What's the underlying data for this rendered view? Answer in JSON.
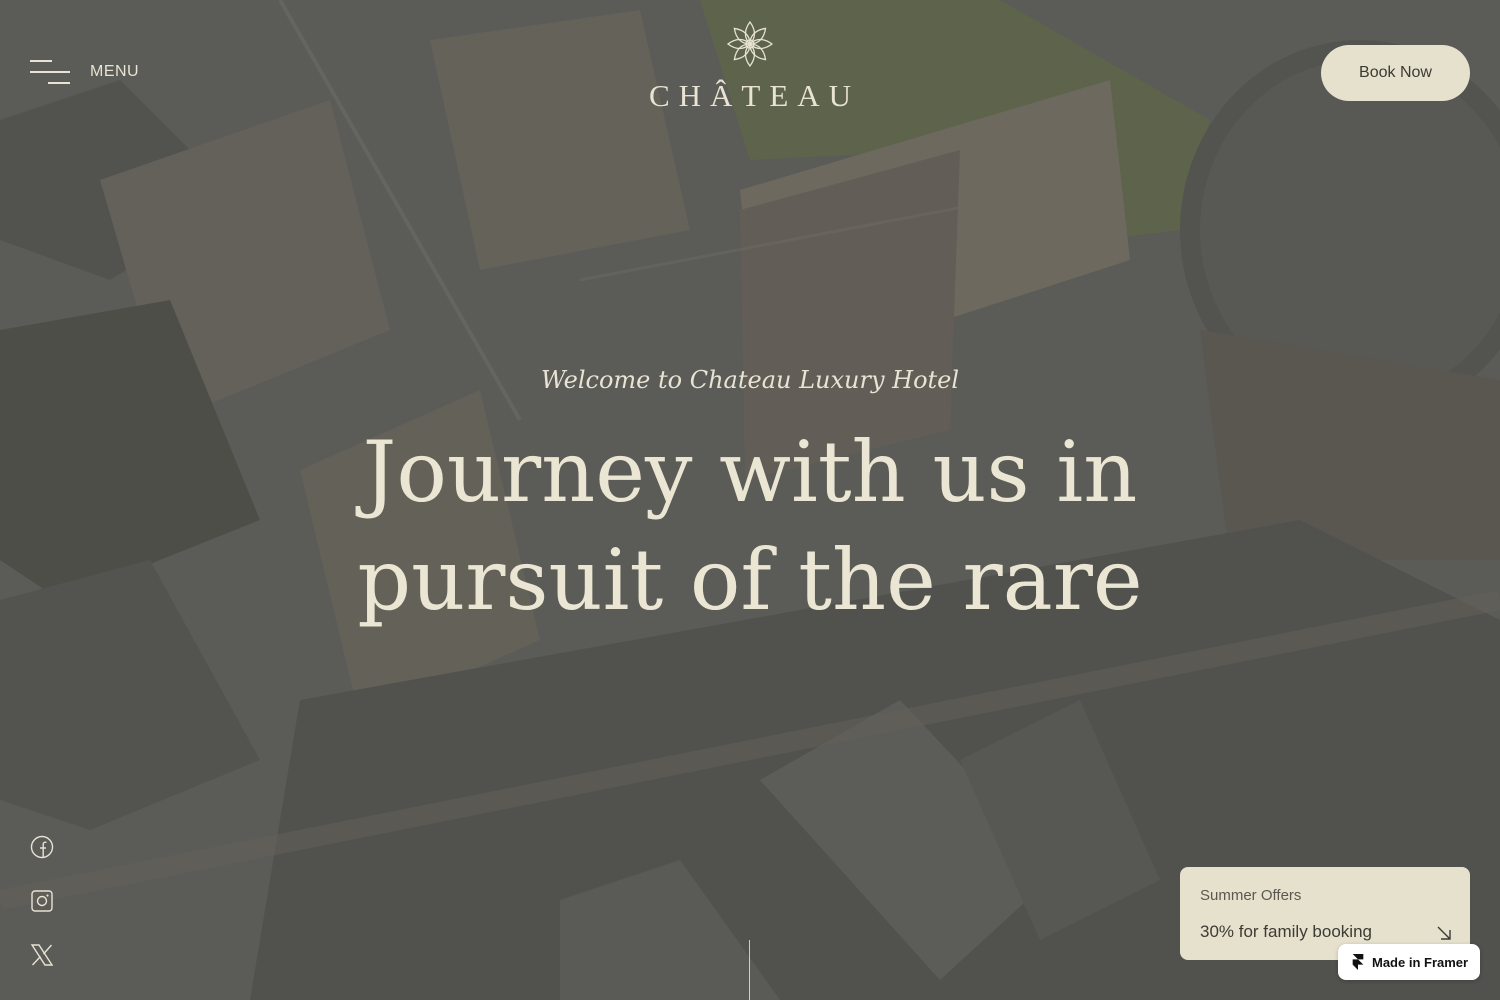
{
  "header": {
    "menu_label": "MENU",
    "logo_text": "CHÂTEAU",
    "book_label": "Book Now"
  },
  "hero": {
    "subtitle": "Welcome to Chateau Luxury Hotel",
    "title_line_1": "Journey with us in",
    "title_line_2": "pursuit of the rare"
  },
  "social": [
    "facebook-icon",
    "instagram-icon",
    "x-twitter-icon"
  ],
  "offer": {
    "label": "Summer Offers",
    "text": "30% for family booking",
    "icon": "arrow-down-right-icon"
  },
  "badge": {
    "text": "Made in Framer",
    "icon": "framer-logo-icon"
  },
  "colors": {
    "cream": "#e6e1cd",
    "text_light": "#e8e3d2",
    "text_dark": "#3a3a36"
  }
}
